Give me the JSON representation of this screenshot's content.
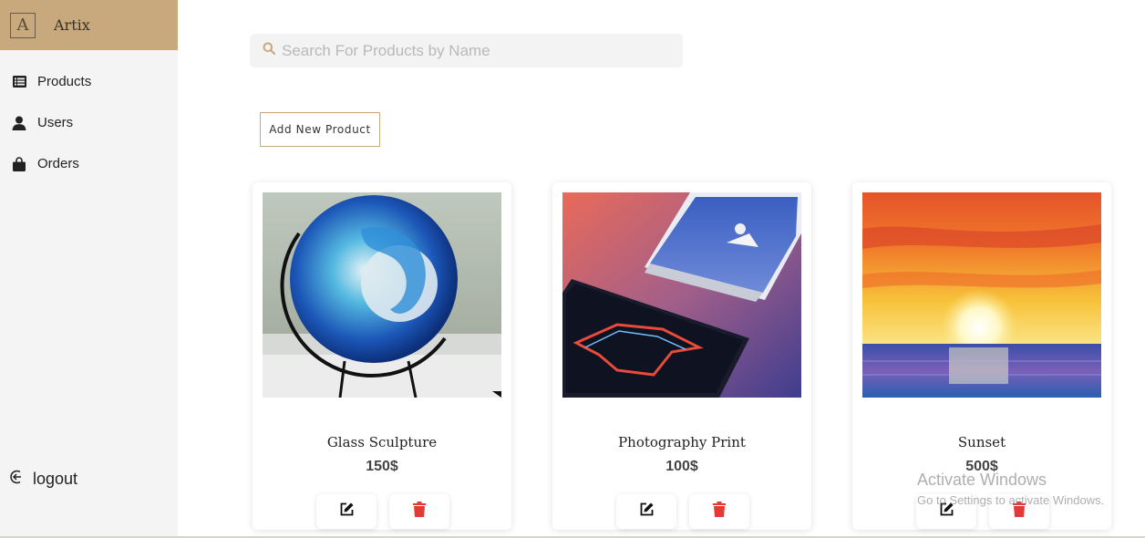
{
  "brand": {
    "logo_letter": "A",
    "name": "Artix",
    "color": "#c8a97e"
  },
  "sidebar": {
    "items": [
      {
        "label": "Products",
        "icon": "list-icon"
      },
      {
        "label": "Users",
        "icon": "user-icon"
      },
      {
        "label": "Orders",
        "icon": "shopping-bag-icon"
      }
    ],
    "logout_label": "logout"
  },
  "search": {
    "placeholder": "Search For Products by Name",
    "value": "",
    "icon": "search-icon"
  },
  "add_button_label": "Add New Product",
  "products": [
    {
      "name": "Glass Sculpture",
      "price": "150$"
    },
    {
      "name": "Photography Print",
      "price": "100$"
    },
    {
      "name": "Sunset",
      "price": "500$"
    }
  ],
  "actions": {
    "edit_icon": "edit-icon",
    "delete_icon": "trash-icon",
    "delete_color": "#e53935"
  },
  "watermark": {
    "line1": "Activate Windows",
    "line2": "Go to Settings to activate Windows."
  }
}
